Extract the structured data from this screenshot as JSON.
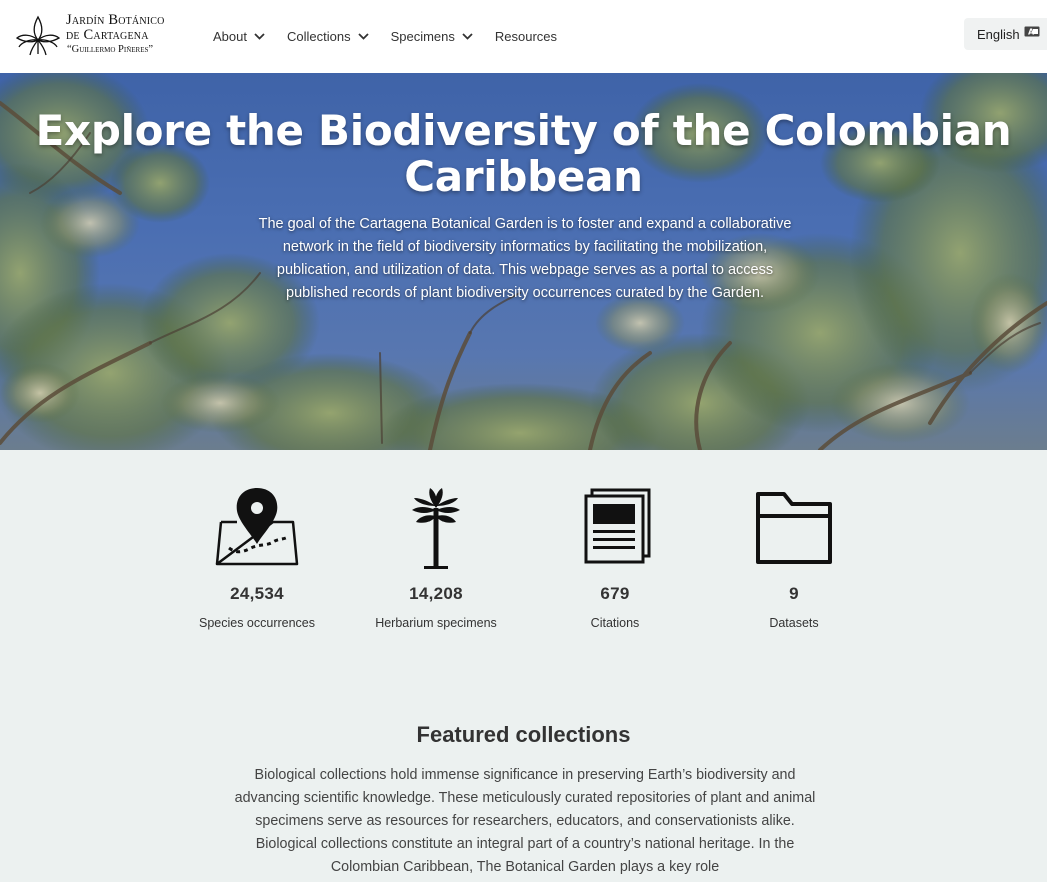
{
  "header": {
    "logo": {
      "line1": "Jardín Botánico",
      "line2": "de Cartagena",
      "line3": "“Guillermo Piñeres”"
    },
    "nav": [
      {
        "label": "About",
        "has_dropdown": true
      },
      {
        "label": "Collections",
        "has_dropdown": true
      },
      {
        "label": "Specimens",
        "has_dropdown": true
      },
      {
        "label": "Resources",
        "has_dropdown": false
      }
    ],
    "language": {
      "label": "English",
      "icon": "language-icon"
    }
  },
  "hero": {
    "title": "Explore the Biodiversity of the Colombian Caribbean",
    "description": "The goal of the Cartagena Botanical Garden is to foster and expand a collaborative network in the field of biodiversity informatics by facilitating the mobilization, publication, and utilization of data. This webpage serves as a portal to access published records of plant biodiversity occurrences curated by the Garden."
  },
  "stats": [
    {
      "icon": "map-pin-icon",
      "value": "24,534",
      "label": "Species occurrences"
    },
    {
      "icon": "palm-tree-icon",
      "value": "14,208",
      "label": "Herbarium specimens"
    },
    {
      "icon": "documents-icon",
      "value": "679",
      "label": "Citations"
    },
    {
      "icon": "folder-icon",
      "value": "9",
      "label": "Datasets"
    }
  ],
  "featured": {
    "title": "Featured collections",
    "text": "Biological collections hold immense significance in preserving Earth’s biodiversity and advancing scientific knowledge. These meticulously curated repositories of plant and animal specimens serve as resources for researchers, educators, and conservationists alike. Biological collections constitute an integral part of a country’s national heritage. In the Colombian Caribbean, The Botanical Garden plays a key role"
  }
}
